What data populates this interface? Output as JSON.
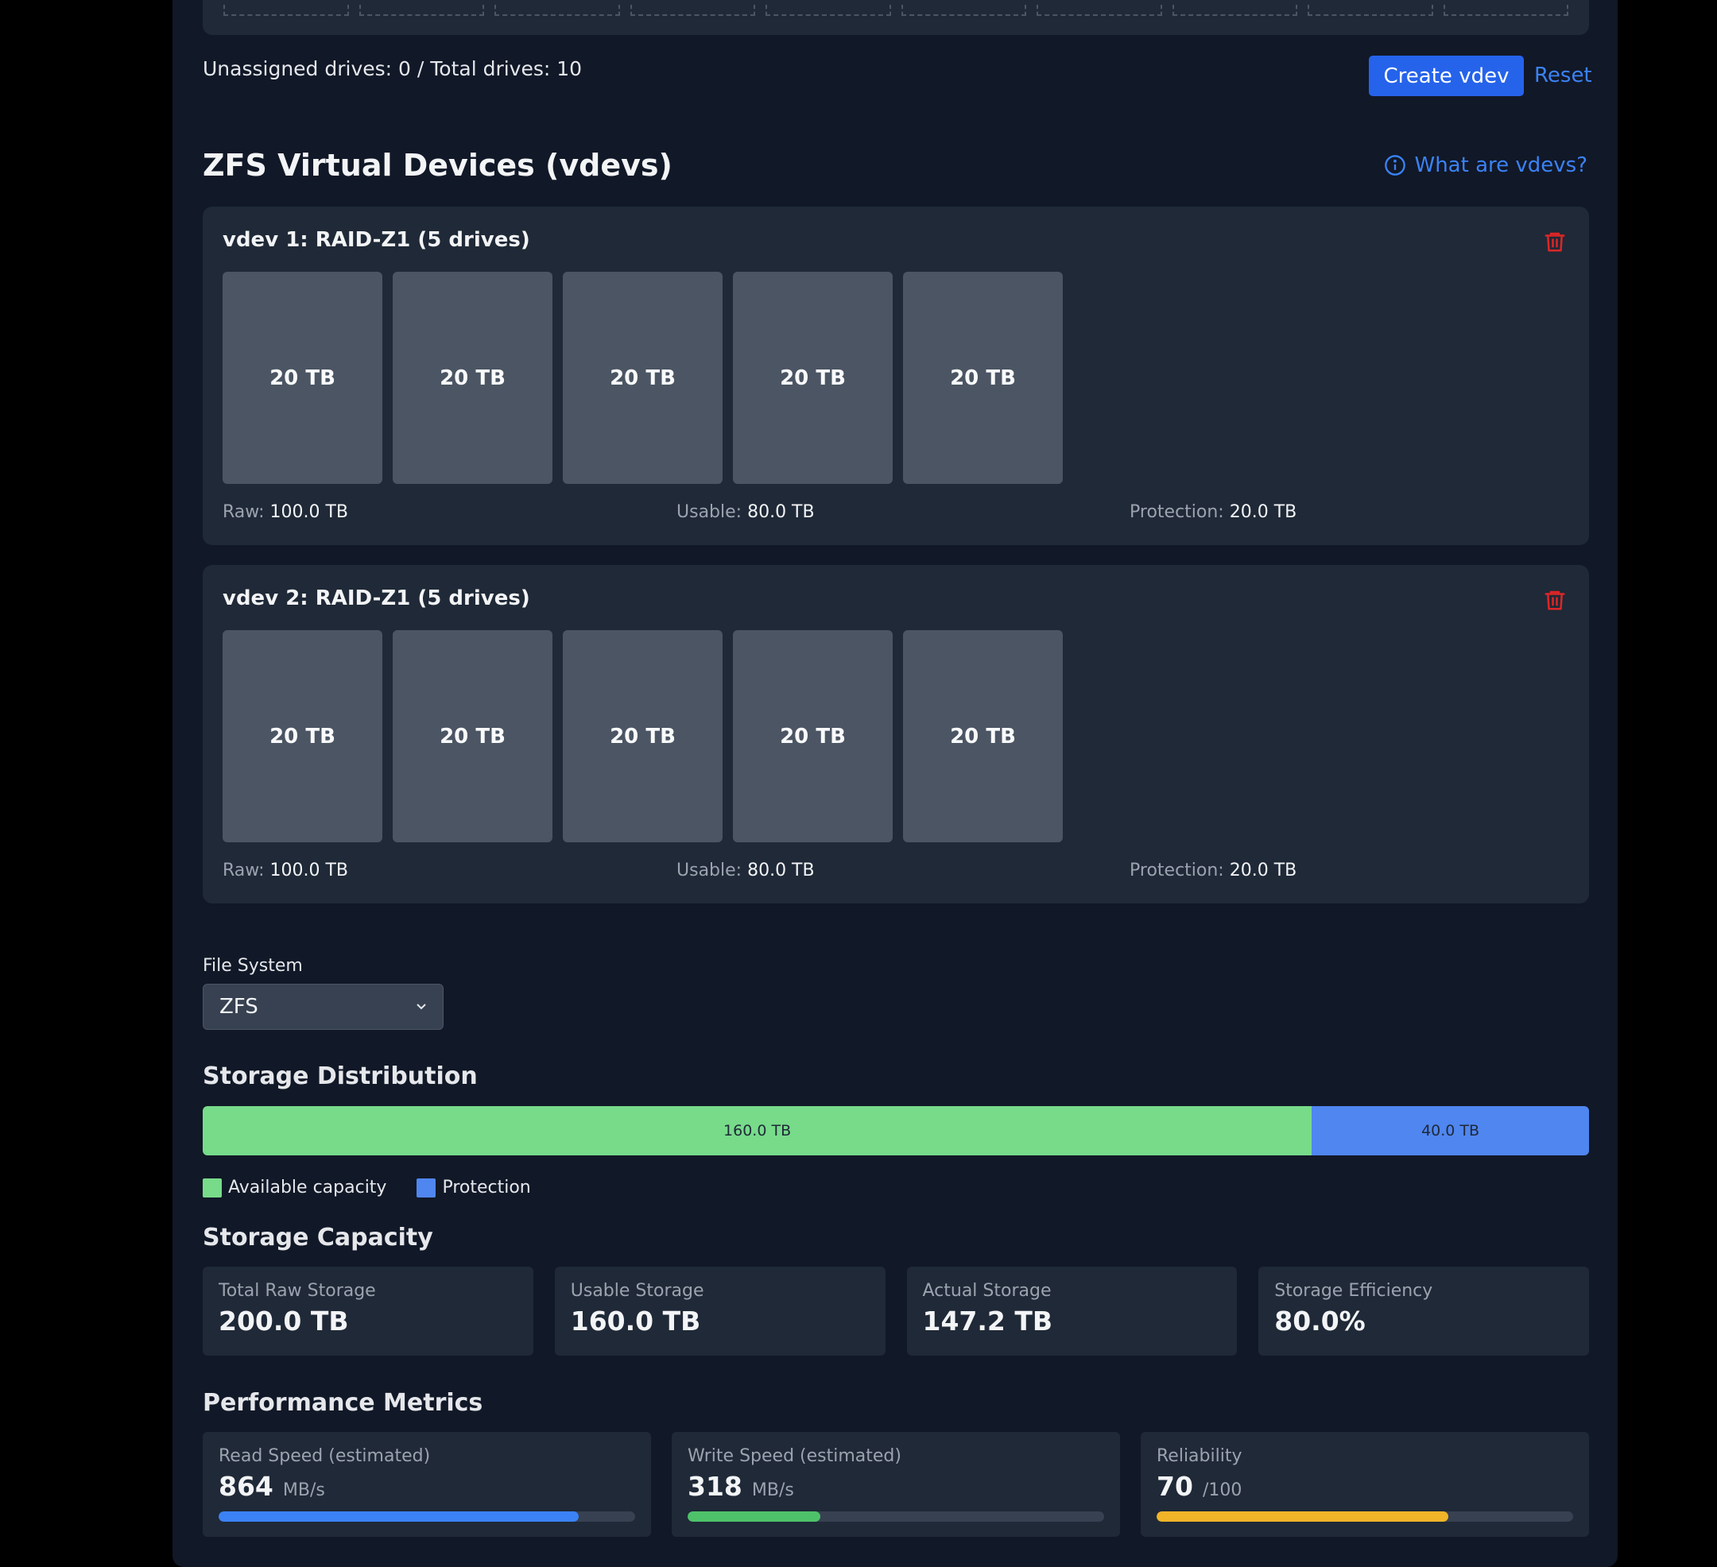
{
  "status": {
    "unassigned_text": "Unassigned drives: 0 / Total drives: 10"
  },
  "actions": {
    "create_label": "Create vdev",
    "reset_label": "Reset"
  },
  "vdev_section": {
    "title": "ZFS Virtual Devices (vdevs)",
    "help_label": "What are vdevs?"
  },
  "vdevs": [
    {
      "title": "vdev 1: RAID-Z1 (5 drives)",
      "drives": [
        "20 TB",
        "20 TB",
        "20 TB",
        "20 TB",
        "20 TB"
      ],
      "raw_label": "Raw:",
      "raw_value": "100.0 TB",
      "usable_label": "Usable:",
      "usable_value": "80.0 TB",
      "protection_label": "Protection:",
      "protection_value": "20.0 TB"
    },
    {
      "title": "vdev 2: RAID-Z1 (5 drives)",
      "drives": [
        "20 TB",
        "20 TB",
        "20 TB",
        "20 TB",
        "20 TB"
      ],
      "raw_label": "Raw:",
      "raw_value": "100.0 TB",
      "usable_label": "Usable:",
      "usable_value": "80.0 TB",
      "protection_label": "Protection:",
      "protection_value": "20.0 TB"
    }
  ],
  "filesystem": {
    "label": "File System",
    "selected": "ZFS"
  },
  "distribution": {
    "title": "Storage Distribution",
    "available_label": "160.0 TB",
    "protection_label": "40.0 TB",
    "available_fraction": 0.8,
    "legend_available": "Available capacity",
    "legend_protection": "Protection",
    "colors": {
      "available": "#77db8a",
      "protection": "#4f86f0"
    }
  },
  "capacity": {
    "title": "Storage Capacity",
    "cards": [
      {
        "label": "Total Raw Storage",
        "value": "200.0 TB"
      },
      {
        "label": "Usable Storage",
        "value": "160.0 TB"
      },
      {
        "label": "Actual Storage",
        "value": "147.2 TB"
      },
      {
        "label": "Storage Efficiency",
        "value": "80.0%"
      }
    ]
  },
  "performance": {
    "title": "Performance Metrics",
    "metrics": [
      {
        "label": "Read Speed (estimated)",
        "value": "864",
        "unit": "MB/s",
        "fraction": 0.864,
        "color": "#3b82f6"
      },
      {
        "label": "Write Speed (estimated)",
        "value": "318",
        "unit": "MB/s",
        "fraction": 0.318,
        "color": "#4ec26a"
      },
      {
        "label": "Reliability",
        "value": "70",
        "unit": "/100",
        "fraction": 0.7,
        "color": "#f0b429"
      }
    ]
  }
}
